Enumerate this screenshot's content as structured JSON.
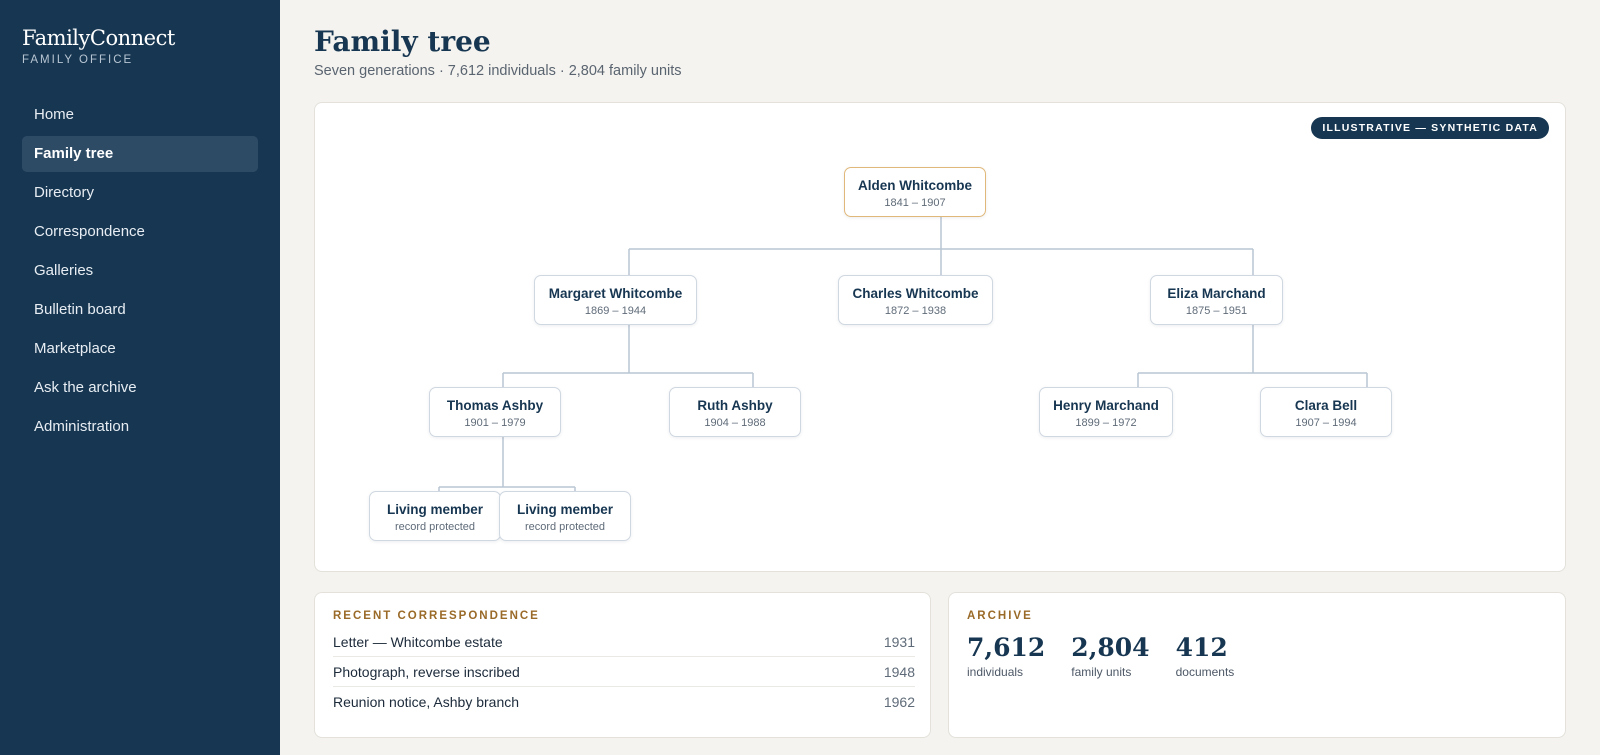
{
  "brand": {
    "name": "FamilyConnect",
    "subtitle": "FAMILY OFFICE"
  },
  "nav": [
    {
      "label": "Home",
      "active": false
    },
    {
      "label": "Family tree",
      "active": true
    },
    {
      "label": "Directory",
      "active": false
    },
    {
      "label": "Correspondence",
      "active": false
    },
    {
      "label": "Galleries",
      "active": false
    },
    {
      "label": "Bulletin board",
      "active": false
    },
    {
      "label": "Marketplace",
      "active": false
    },
    {
      "label": "Ask the archive",
      "active": false
    },
    {
      "label": "Administration",
      "active": false
    }
  ],
  "page": {
    "title": "Family tree",
    "subtitle": "Seven generations · 7,612 individuals · 2,804 family units"
  },
  "tree": {
    "badge": "ILLUSTRATIVE — SYNTHETIC DATA",
    "people": {
      "alden": {
        "name": "Alden Whitcombe",
        "dates": "1841 – 1907"
      },
      "margaret": {
        "name": "Margaret Whitcombe",
        "dates": "1869 – 1944"
      },
      "charles": {
        "name": "Charles Whitcombe",
        "dates": "1872 – 1938"
      },
      "eliza": {
        "name": "Eliza Marchand",
        "dates": "1875 – 1951"
      },
      "thomas": {
        "name": "Thomas Ashby",
        "dates": "1901 – 1979"
      },
      "ruth": {
        "name": "Ruth Ashby",
        "dates": "1904 – 1988"
      },
      "henry": {
        "name": "Henry Marchand",
        "dates": "1899 – 1972"
      },
      "clara": {
        "name": "Clara Bell",
        "dates": "1907 – 1994"
      },
      "living1": {
        "name": "Living member",
        "dates": "record protected"
      },
      "living2": {
        "name": "Living member",
        "dates": "record protected"
      }
    }
  },
  "correspondence": {
    "label": "RECENT CORRESPONDENCE",
    "items": [
      {
        "title": "Letter — Whitcombe estate",
        "year": "1931"
      },
      {
        "title": "Photograph, reverse inscribed",
        "year": "1948"
      },
      {
        "title": "Reunion notice, Ashby branch",
        "year": "1962"
      }
    ]
  },
  "archive": {
    "label": "ARCHIVE",
    "stats": [
      {
        "value": "7,612",
        "label": "individuals"
      },
      {
        "value": "2,804",
        "label": "family units"
      },
      {
        "value": "412",
        "label": "documents"
      }
    ]
  },
  "colors": {
    "sidebar": "#173651",
    "accent": "#9a6a28",
    "root_border": "#e0b87a",
    "connector": "#b9c6d3"
  }
}
